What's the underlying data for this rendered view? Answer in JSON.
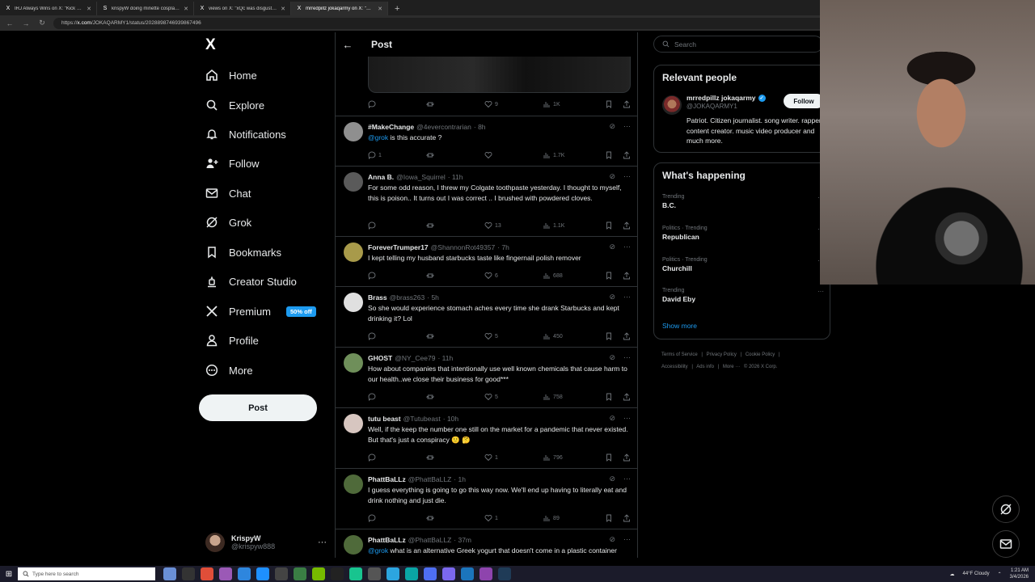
{
  "browser": {
    "tabs": [
      {
        "favicon": "X",
        "title": "IRJ Always Wins on X: \"Kick Stream"
      },
      {
        "favicon": "S",
        "title": "krispyW doing minette cosplay - e"
      },
      {
        "favicon": "X",
        "title": "views on X: \"xQc was disgusted a"
      },
      {
        "favicon": "X",
        "title": "mrredpillz jokaqarmy on X: \"Cons"
      }
    ],
    "active_tab": 3,
    "new_tab": "+",
    "url_prefix": "https://",
    "url_host": "x.com",
    "url_path": "/JOKAQARMY1/status/2028898746939867496"
  },
  "nav": {
    "logo": "X",
    "items": [
      {
        "label": "Home",
        "icon": "home-icon"
      },
      {
        "label": "Explore",
        "icon": "search-icon"
      },
      {
        "label": "Notifications",
        "icon": "bell-icon"
      },
      {
        "label": "Follow",
        "icon": "person-add-icon"
      },
      {
        "label": "Chat",
        "icon": "mail-icon"
      },
      {
        "label": "Grok",
        "icon": "grok-icon"
      },
      {
        "label": "Bookmarks",
        "icon": "bookmark-icon"
      },
      {
        "label": "Creator Studio",
        "icon": "creator-icon"
      },
      {
        "label": "Premium",
        "icon": "x-logo-icon",
        "badge": "50% off"
      },
      {
        "label": "Profile",
        "icon": "profile-icon"
      },
      {
        "label": "More",
        "icon": "more-circle-icon"
      }
    ],
    "post_button": "Post",
    "account": {
      "name": "KrispyW",
      "handle": "@krispyw888",
      "more": "···"
    }
  },
  "main": {
    "header_title": "Post",
    "top_metrics": {
      "replies": "",
      "reposts": "",
      "likes": "9",
      "views": "1K"
    },
    "replies": [
      {
        "name": "#MakeChange",
        "handle": "@4evercontrarian",
        "time": "· 8h",
        "mention": "@grok",
        "text": " is this accurate ?",
        "replies": "1",
        "reposts": "",
        "likes": "",
        "views": "1.7K",
        "avatar": "#8f8f8f"
      },
      {
        "name": "Anna B.",
        "handle": "@Iowa_Squirrel",
        "time": "· 11h",
        "mention": "",
        "text": "For some odd reason, I threw my Colgate toothpaste yesterday. I thought to myself, this is poison.. It turns out I was correct .. I brushed with powdered cloves.",
        "replies": "",
        "reposts": "",
        "likes": "13",
        "views": "1.1K",
        "avatar": "#5a5a5a"
      },
      {
        "name": "ForeverTrumper17",
        "handle": "@ShannonRot49357",
        "time": "· 7h",
        "mention": "",
        "text": "I kept telling my husband starbucks taste like fingernail polish remover",
        "replies": "",
        "reposts": "",
        "likes": "6",
        "views": "688",
        "avatar": "#a89a4a"
      },
      {
        "name": "Brass",
        "handle": "@brass263",
        "time": "· 5h",
        "mention": "",
        "text": "So she would experience stomach aches every time she drank Starbucks and kept drinking it? Lol",
        "replies": "",
        "reposts": "",
        "likes": "5",
        "views": "450",
        "avatar": "#e0e0e0"
      },
      {
        "name": "GHOST",
        "handle": "@NY_Cee79",
        "time": "· 11h",
        "mention": "",
        "text": "How about companies that intentionally use well known chemicals that cause harm to our health..we close their business for good***",
        "replies": "",
        "reposts": "",
        "likes": "5",
        "views": "758",
        "avatar": "#6f8f5a"
      },
      {
        "name": "tutu beast",
        "handle": "@Tutubeast",
        "time": "· 10h",
        "mention": "",
        "text": "Well, if the keep the number one still on the market for a pandemic that never existed.  But that's just a conspiracy 🙂 🤔",
        "replies": "",
        "reposts": "",
        "likes": "1",
        "views": "796",
        "avatar": "#d7c6c0"
      },
      {
        "name": "PhattBaLLz",
        "handle": "@PhattBaLLZ",
        "time": "· 1h",
        "mention": "",
        "text": "I guess everything is going to go this way now.  We'll end up having to literally eat and drink nothing and just die.",
        "replies": "",
        "reposts": "",
        "likes": "1",
        "views": "89",
        "avatar": "#4f6a3a"
      },
      {
        "name": "PhattBaLLz",
        "handle": "@PhattBaLLZ",
        "time": "· 37m",
        "mention": "@grok",
        "text": " what is an alternative Greek yogurt that doesn't come in a plastic container",
        "replies": "",
        "reposts": "",
        "likes": "",
        "views": "",
        "avatar": "#4f6a3a"
      }
    ]
  },
  "right": {
    "search_placeholder": "Search",
    "relevant": {
      "title": "Relevant people",
      "name": "mrredpillz jokaqarmy",
      "handle": "@JOKAQARMY1",
      "follow": "Follow",
      "bio": "Patriot. Citizen journalist. song writer. rapper content creator. music video producer and much more."
    },
    "happening": {
      "title": "What's happening",
      "trends": [
        {
          "category": "Trending",
          "topic": "B.C."
        },
        {
          "category": "Politics · Trending",
          "topic": "Republican"
        },
        {
          "category": "Politics · Trending",
          "topic": "Churchill"
        },
        {
          "category": "Trending",
          "topic": "David Eby"
        }
      ],
      "show_more": "Show more"
    },
    "footer": [
      "Terms of Service",
      "|",
      "Privacy Policy",
      "|",
      "Cookie Policy",
      "|",
      "Accessibility",
      "|",
      "Ads info",
      "|",
      "More ···",
      "© 2026 X Corp."
    ]
  },
  "taskbar": {
    "search_placeholder": "Type here to search",
    "weather": "44°F  Cloudy",
    "time": "1:21 AM",
    "date": "3/4/2026"
  },
  "colors": {
    "accent": "#1d9bf0",
    "background": "#000000",
    "border": "#2f3336",
    "muted": "#71767b"
  }
}
